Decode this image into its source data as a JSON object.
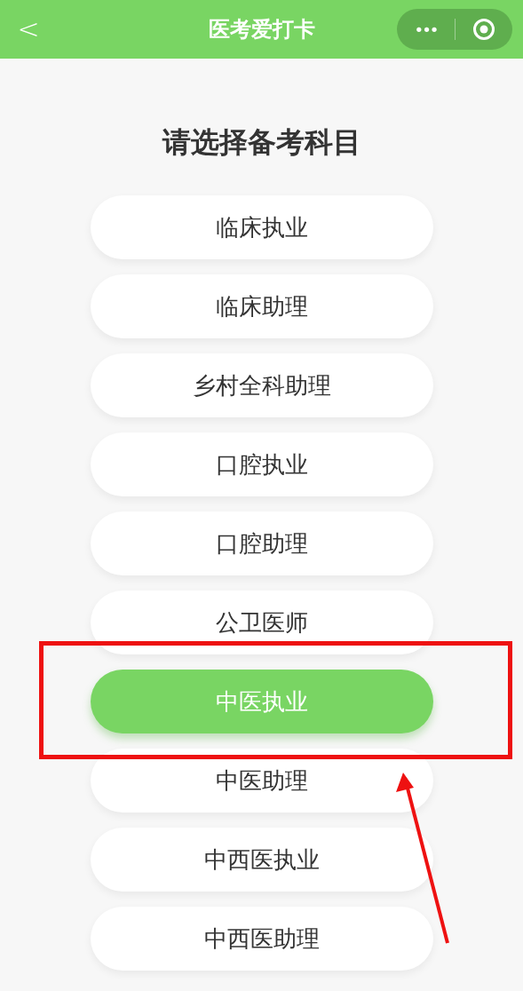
{
  "nav": {
    "back": "<",
    "title": "医考爱打卡",
    "more": "•••"
  },
  "heading": "请选择备考科目",
  "options": [
    {
      "label": "临床执业",
      "selected": false
    },
    {
      "label": "临床助理",
      "selected": false
    },
    {
      "label": "乡村全科助理",
      "selected": false
    },
    {
      "label": "口腔执业",
      "selected": false
    },
    {
      "label": "口腔助理",
      "selected": false
    },
    {
      "label": "公卫医师",
      "selected": false
    },
    {
      "label": "中医执业",
      "selected": true,
      "highlighted": true
    },
    {
      "label": "中医助理",
      "selected": false
    },
    {
      "label": "中西医执业",
      "selected": false
    },
    {
      "label": "中西医助理",
      "selected": false
    }
  ]
}
